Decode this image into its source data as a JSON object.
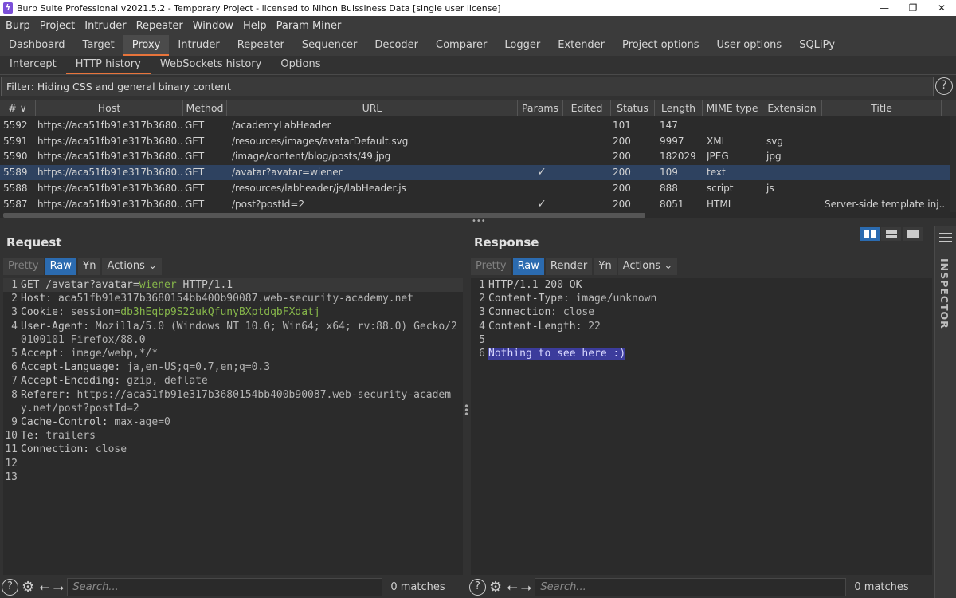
{
  "window": {
    "title": "Burp Suite Professional v2021.5.2 - Temporary Project - licensed to Nihon Buissiness Data [single user license]",
    "minimize": "—",
    "maximize": "❐",
    "close": "✕"
  },
  "menu": [
    "Burp",
    "Project",
    "Intruder",
    "Repeater",
    "Window",
    "Help",
    "Param Miner"
  ],
  "main_tabs": [
    "Dashboard",
    "Target",
    "Proxy",
    "Intruder",
    "Repeater",
    "Sequencer",
    "Decoder",
    "Comparer",
    "Logger",
    "Extender",
    "Project options",
    "User options",
    "SQLiPy"
  ],
  "main_tab_active": "Proxy",
  "proxy_tabs": [
    "Intercept",
    "HTTP history",
    "WebSockets history",
    "Options"
  ],
  "proxy_tab_active": "HTTP history",
  "filter": "Filter: Hiding CSS and general binary content",
  "history": {
    "columns": [
      "# ∨",
      "Host",
      "Method",
      "URL",
      "Params",
      "Edited",
      "Status",
      "Length",
      "MIME type",
      "Extension",
      "Title"
    ],
    "rows": [
      {
        "id": "5592",
        "host": "https://aca51fb91e317b3680...",
        "method": "GET",
        "url": "/academyLabHeader",
        "params": "",
        "edited": "",
        "status": "101",
        "length": "147",
        "mime": "",
        "ext": "",
        "title": ""
      },
      {
        "id": "5591",
        "host": "https://aca51fb91e317b3680...",
        "method": "GET",
        "url": "/resources/images/avatarDefault.svg",
        "params": "",
        "edited": "",
        "status": "200",
        "length": "9997",
        "mime": "XML",
        "ext": "svg",
        "title": ""
      },
      {
        "id": "5590",
        "host": "https://aca51fb91e317b3680...",
        "method": "GET",
        "url": "/image/content/blog/posts/49.jpg",
        "params": "",
        "edited": "",
        "status": "200",
        "length": "182029",
        "mime": "JPEG",
        "ext": "jpg",
        "title": ""
      },
      {
        "id": "5589",
        "host": "https://aca51fb91e317b3680...",
        "method": "GET",
        "url": "/avatar?avatar=wiener",
        "params": "✓",
        "edited": "",
        "status": "200",
        "length": "109",
        "mime": "text",
        "ext": "",
        "title": ""
      },
      {
        "id": "5588",
        "host": "https://aca51fb91e317b3680...",
        "method": "GET",
        "url": "/resources/labheader/js/labHeader.js",
        "params": "",
        "edited": "",
        "status": "200",
        "length": "888",
        "mime": "script",
        "ext": "js",
        "title": ""
      },
      {
        "id": "5587",
        "host": "https://aca51fb91e317b3680...",
        "method": "GET",
        "url": "/post?postId=2",
        "params": "✓",
        "edited": "",
        "status": "200",
        "length": "8051",
        "mime": "HTML",
        "ext": "",
        "title": "Server-side template inj..."
      }
    ],
    "selected_id": "5589"
  },
  "request": {
    "title": "Request",
    "buttons": {
      "pretty": "Pretty",
      "raw": "Raw",
      "newline": "¥n",
      "actions": "Actions"
    },
    "lines": [
      {
        "n": "1",
        "parts": [
          [
            "k",
            "GET /avatar?avatar="
          ],
          [
            "g",
            "wiener"
          ],
          [
            "k",
            " HTTP/1.1"
          ]
        ]
      },
      {
        "n": "2",
        "parts": [
          [
            "k",
            "Host: "
          ],
          [
            "v",
            "aca51fb91e317b3680154bb400b90087.web-security-academy.net"
          ]
        ]
      },
      {
        "n": "3",
        "parts": [
          [
            "k",
            "Cookie: "
          ],
          [
            "v",
            "session="
          ],
          [
            "g",
            "db3hEqbp9S22ukQfunyBXptdqbFXdatj"
          ]
        ]
      },
      {
        "n": "4",
        "parts": [
          [
            "k",
            "User-Agent: "
          ],
          [
            "v",
            "Mozilla/5.0 (Windows NT 10.0; Win64; x64; rv:88.0) Gecko/20100101 Firefox/88.0"
          ]
        ]
      },
      {
        "n": "5",
        "parts": [
          [
            "k",
            "Accept: "
          ],
          [
            "v",
            "image/webp,*/*"
          ]
        ]
      },
      {
        "n": "6",
        "parts": [
          [
            "k",
            "Accept-Language: "
          ],
          [
            "v",
            "ja,en-US;q=0.7,en;q=0.3"
          ]
        ]
      },
      {
        "n": "7",
        "parts": [
          [
            "k",
            "Accept-Encoding: "
          ],
          [
            "v",
            "gzip, deflate"
          ]
        ]
      },
      {
        "n": "8",
        "parts": [
          [
            "k",
            "Referer: "
          ],
          [
            "v",
            "https://aca51fb91e317b3680154bb400b90087.web-security-academy.net/post?postId=2"
          ]
        ]
      },
      {
        "n": "9",
        "parts": [
          [
            "k",
            "Cache-Control: "
          ],
          [
            "v",
            "max-age=0"
          ]
        ]
      },
      {
        "n": "10",
        "parts": [
          [
            "k",
            "Te: "
          ],
          [
            "v",
            "trailers"
          ]
        ]
      },
      {
        "n": "11",
        "parts": [
          [
            "k",
            "Connection: "
          ],
          [
            "v",
            "close"
          ]
        ]
      },
      {
        "n": "12",
        "parts": []
      },
      {
        "n": "13",
        "parts": []
      }
    ],
    "search_placeholder": "Search...",
    "matches": "0 matches"
  },
  "response": {
    "title": "Response",
    "buttons": {
      "pretty": "Pretty",
      "raw": "Raw",
      "render": "Render",
      "newline": "¥n",
      "actions": "Actions"
    },
    "lines": [
      {
        "n": "1",
        "parts": [
          [
            "k",
            "HTTP/1.1 200 OK"
          ]
        ]
      },
      {
        "n": "2",
        "parts": [
          [
            "k",
            "Content-Type: "
          ],
          [
            "v",
            "image/unknown"
          ]
        ]
      },
      {
        "n": "3",
        "parts": [
          [
            "k",
            "Connection: "
          ],
          [
            "v",
            "close"
          ]
        ]
      },
      {
        "n": "4",
        "parts": [
          [
            "k",
            "Content-Length: "
          ],
          [
            "v",
            "22"
          ]
        ]
      },
      {
        "n": "5",
        "parts": []
      },
      {
        "n": "6",
        "parts": [
          [
            "sel",
            "Nothing to see here :)"
          ]
        ]
      }
    ],
    "search_placeholder": "Search...",
    "matches": "0 matches"
  },
  "inspector_label": "INSPECTOR",
  "colors": {
    "accent": "#e8743b",
    "selected_row": "#2e4260",
    "active_button": "#2b6bb0",
    "value_green": "#86b64a"
  }
}
